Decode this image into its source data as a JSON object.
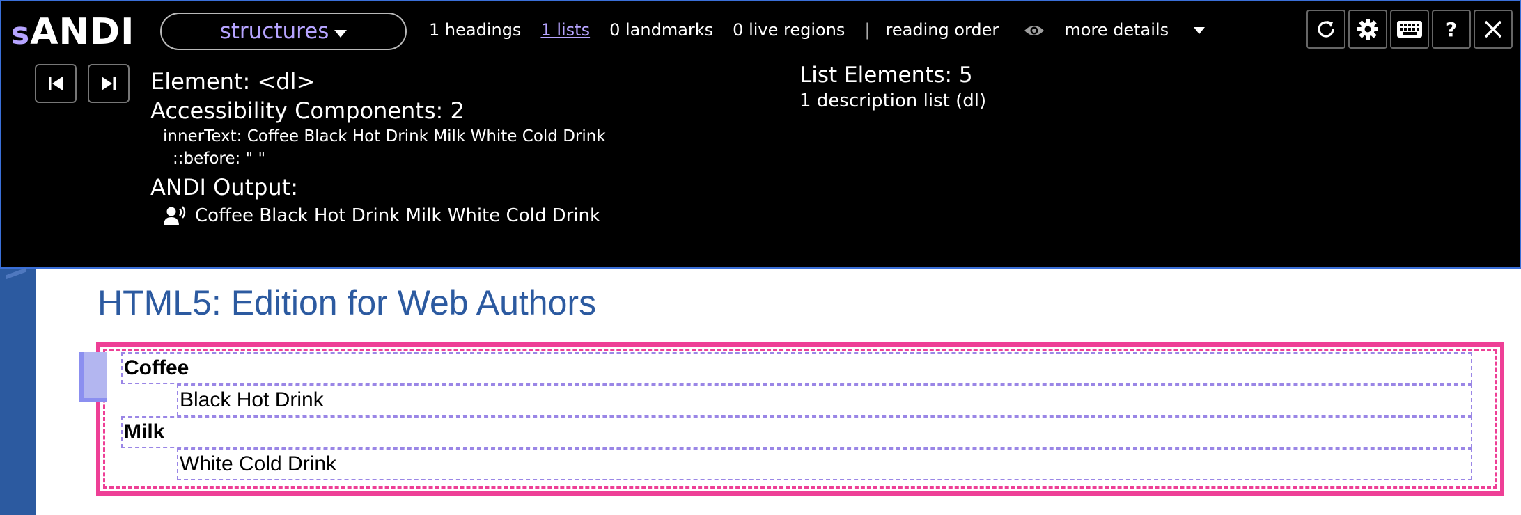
{
  "andi": {
    "logo_prefix": "s",
    "logo_main": "ANDI",
    "module_label": "structures",
    "links": {
      "headings": "1 headings",
      "lists": "1 lists",
      "landmarks": "0 landmarks",
      "live_regions": "0 live regions",
      "separator": "|",
      "reading_order": "reading order",
      "more_details": "more details"
    },
    "buttons": {
      "refresh_icon": "refresh-icon",
      "settings_icon": "gear-icon",
      "keyboard_icon": "keyboard-icon",
      "help_label": "?",
      "close_icon": "close-icon"
    },
    "element_line": "Element: <dl>",
    "components_line": "Accessibility Components: 2",
    "inner_text_line": "innerText: Coffee Black Hot Drink Milk White Cold Drink",
    "before_line": "::before: \" \"",
    "output_heading": "ANDI Output:",
    "output_text": "Coffee Black Hot Drink Milk White Cold Drink",
    "list_elements": "List Elements: 5",
    "list_detail": "1 description list (dl)"
  },
  "page": {
    "title": "HTML5: Edition for Web Authors",
    "items": [
      {
        "term": "Coffee",
        "description": "Black Hot Drink"
      },
      {
        "term": "Milk",
        "description": "White Cold Drink"
      }
    ]
  },
  "colors": {
    "andi_link": "#b6a4ff",
    "title_blue": "#2c5aa0",
    "highlight_pink": "#ee3f96",
    "dashed_purple": "#9a86e6"
  }
}
